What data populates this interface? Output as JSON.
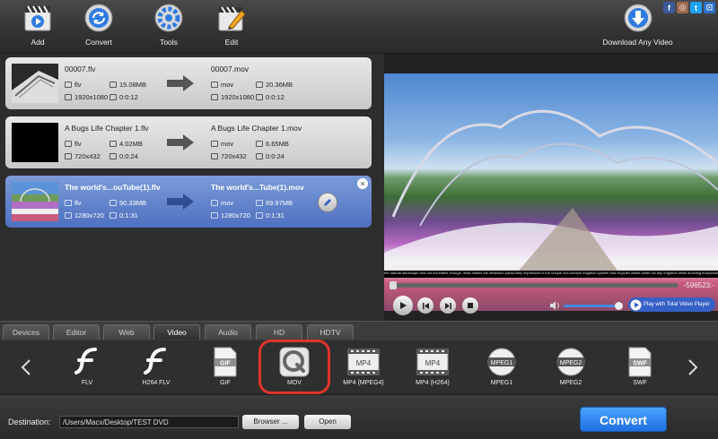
{
  "toolbar": {
    "add": "Add",
    "convert": "Convert",
    "tools": "Tools",
    "edit": "Edit",
    "download": "Download Any Video"
  },
  "social": [
    "f",
    "◎",
    "t",
    "⊡"
  ],
  "files": [
    {
      "src_name": "00007.flv",
      "src_format": "flv",
      "src_size": "15.08MB",
      "src_res": "1920x1080",
      "src_dur": "0:0:12",
      "out_name": "00007.mov",
      "out_format": "mov",
      "out_size": "20.36MB",
      "out_res": "1920x1080",
      "out_dur": "0:0:12"
    },
    {
      "src_name": "A Bugs Life Chapter 1.flv",
      "src_format": "flv",
      "src_size": "4.02MB",
      "src_res": "720x432",
      "src_dur": "0:0:24",
      "out_name": "A Bugs Life Chapter 1.mov",
      "out_format": "mov",
      "out_size": "6.65MB",
      "out_res": "720x432",
      "out_dur": "0:0:24"
    },
    {
      "src_name": "The world's...ouTube(1).flv",
      "src_format": "flv",
      "src_size": "50.33MB",
      "src_res": "1280x720",
      "src_dur": "0:1:31",
      "out_name": "The world's...Tube(1).mov",
      "out_format": "mov",
      "out_size": "69.97MB",
      "out_res": "1280x720",
      "out_dur": "0:1:31"
    }
  ],
  "player": {
    "caption": "the natural landscape was not incredible enough, what makes the attraction particularly impressive is the unique sub-surface irrigation system that recycles waste water via drip irrigation while avoiding evaporation and saving up to 75 per cent of water and energy",
    "time": "-596523:-",
    "play_total": "Play with Total Video Player"
  },
  "tabs": [
    "Devices",
    "Editor",
    "Web",
    "Video",
    "Audio",
    "HD",
    "HDTV"
  ],
  "active_tab": "Video",
  "formats": [
    "FLV",
    "H264 FLV",
    "GIF",
    "MOV",
    "MP4 (MPEG4)",
    "MP4 (H264)",
    "MPEG1",
    "MPEG2",
    "SWF"
  ],
  "format_icon_text": {
    "gif": "GIF",
    "mp4": "MP4",
    "mpeg1": "MPEG1",
    "mpeg2": "MPEG2",
    "swf": "SWF"
  },
  "destination": {
    "label": "Destination:",
    "path": "/Users/Macx/Desktop/TEST DVD",
    "browse": "Browser ...",
    "open": "Open",
    "convert": "Convert"
  }
}
